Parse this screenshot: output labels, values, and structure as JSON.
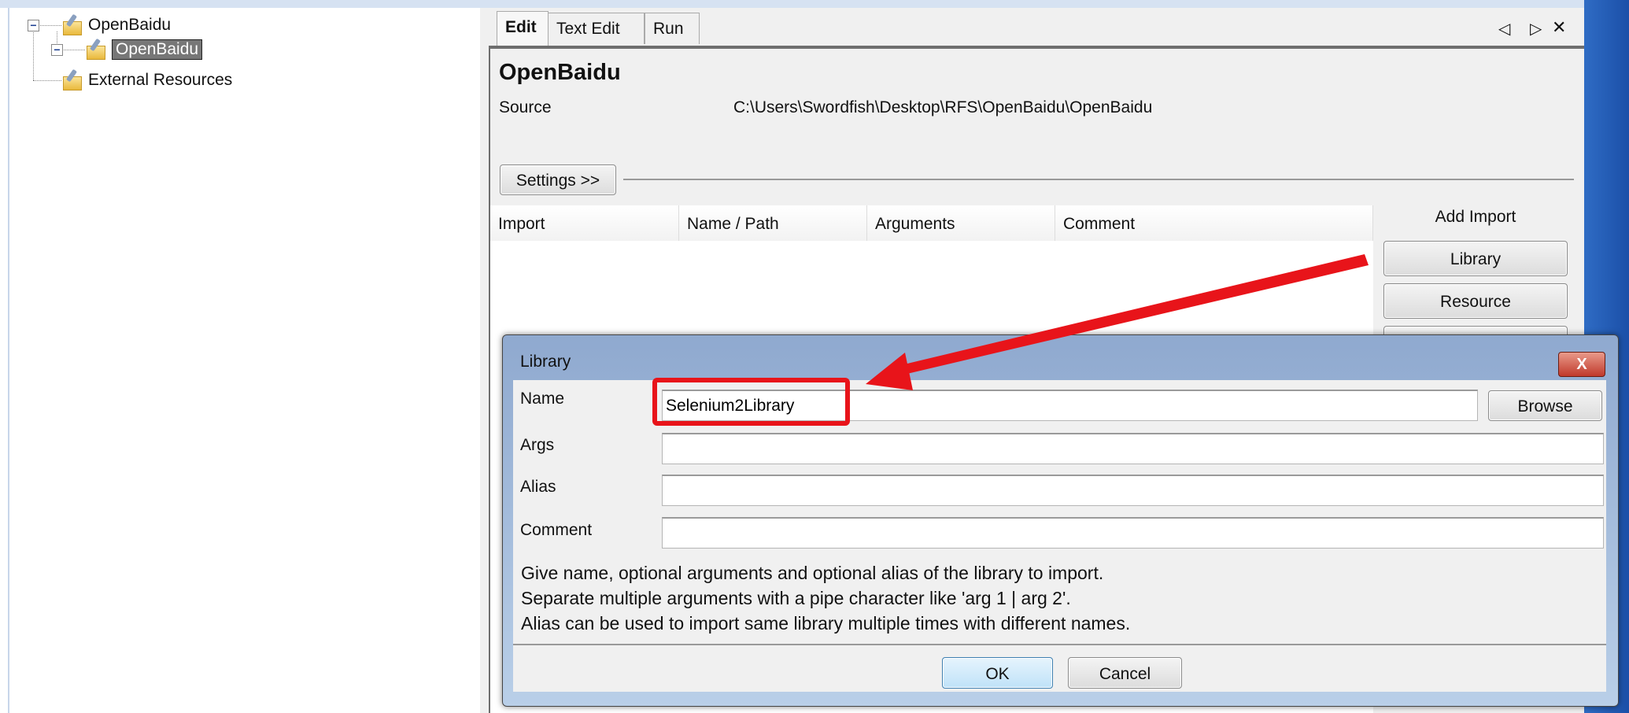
{
  "tree": {
    "items": [
      {
        "label": "OpenBaidu",
        "icon": "suite-folder-icon"
      },
      {
        "label": "OpenBaidu",
        "icon": "suite-folder-icon",
        "selected": true
      },
      {
        "label": "External Resources",
        "icon": "resource-folder-icon"
      }
    ]
  },
  "tabs": [
    {
      "label": "Edit",
      "active": true
    },
    {
      "label": "Text Edit"
    },
    {
      "label": "Run"
    }
  ],
  "tab_controls": {
    "prev": "◁",
    "next": "▷",
    "close": "✕"
  },
  "editor": {
    "title": "OpenBaidu",
    "source_label": "Source",
    "source_value": "C:\\Users\\Swordfish\\Desktop\\RFS\\OpenBaidu\\OpenBaidu",
    "settings_button": "Settings >>",
    "table_headers": [
      "Import",
      "Name / Path",
      "Arguments",
      "Comment"
    ],
    "add_import_label": "Add Import",
    "add_buttons": [
      "Library",
      "Resource"
    ]
  },
  "dialog": {
    "title": "Library",
    "close": "X",
    "fields": {
      "name_label": "Name",
      "name_value": "Selenium2Library",
      "args_label": "Args",
      "args_value": "",
      "alias_label": "Alias",
      "alias_value": "",
      "comment_label": "Comment",
      "comment_value": ""
    },
    "browse": "Browse",
    "help": [
      "Give name, optional arguments and optional alias of the library to import.",
      "Separate multiple arguments with a pipe character like 'arg 1 | arg 2'.",
      "Alias can be used to import same library multiple times with different names."
    ],
    "ok": "OK",
    "cancel": "Cancel"
  },
  "annotation": {
    "color": "#e8141a"
  }
}
